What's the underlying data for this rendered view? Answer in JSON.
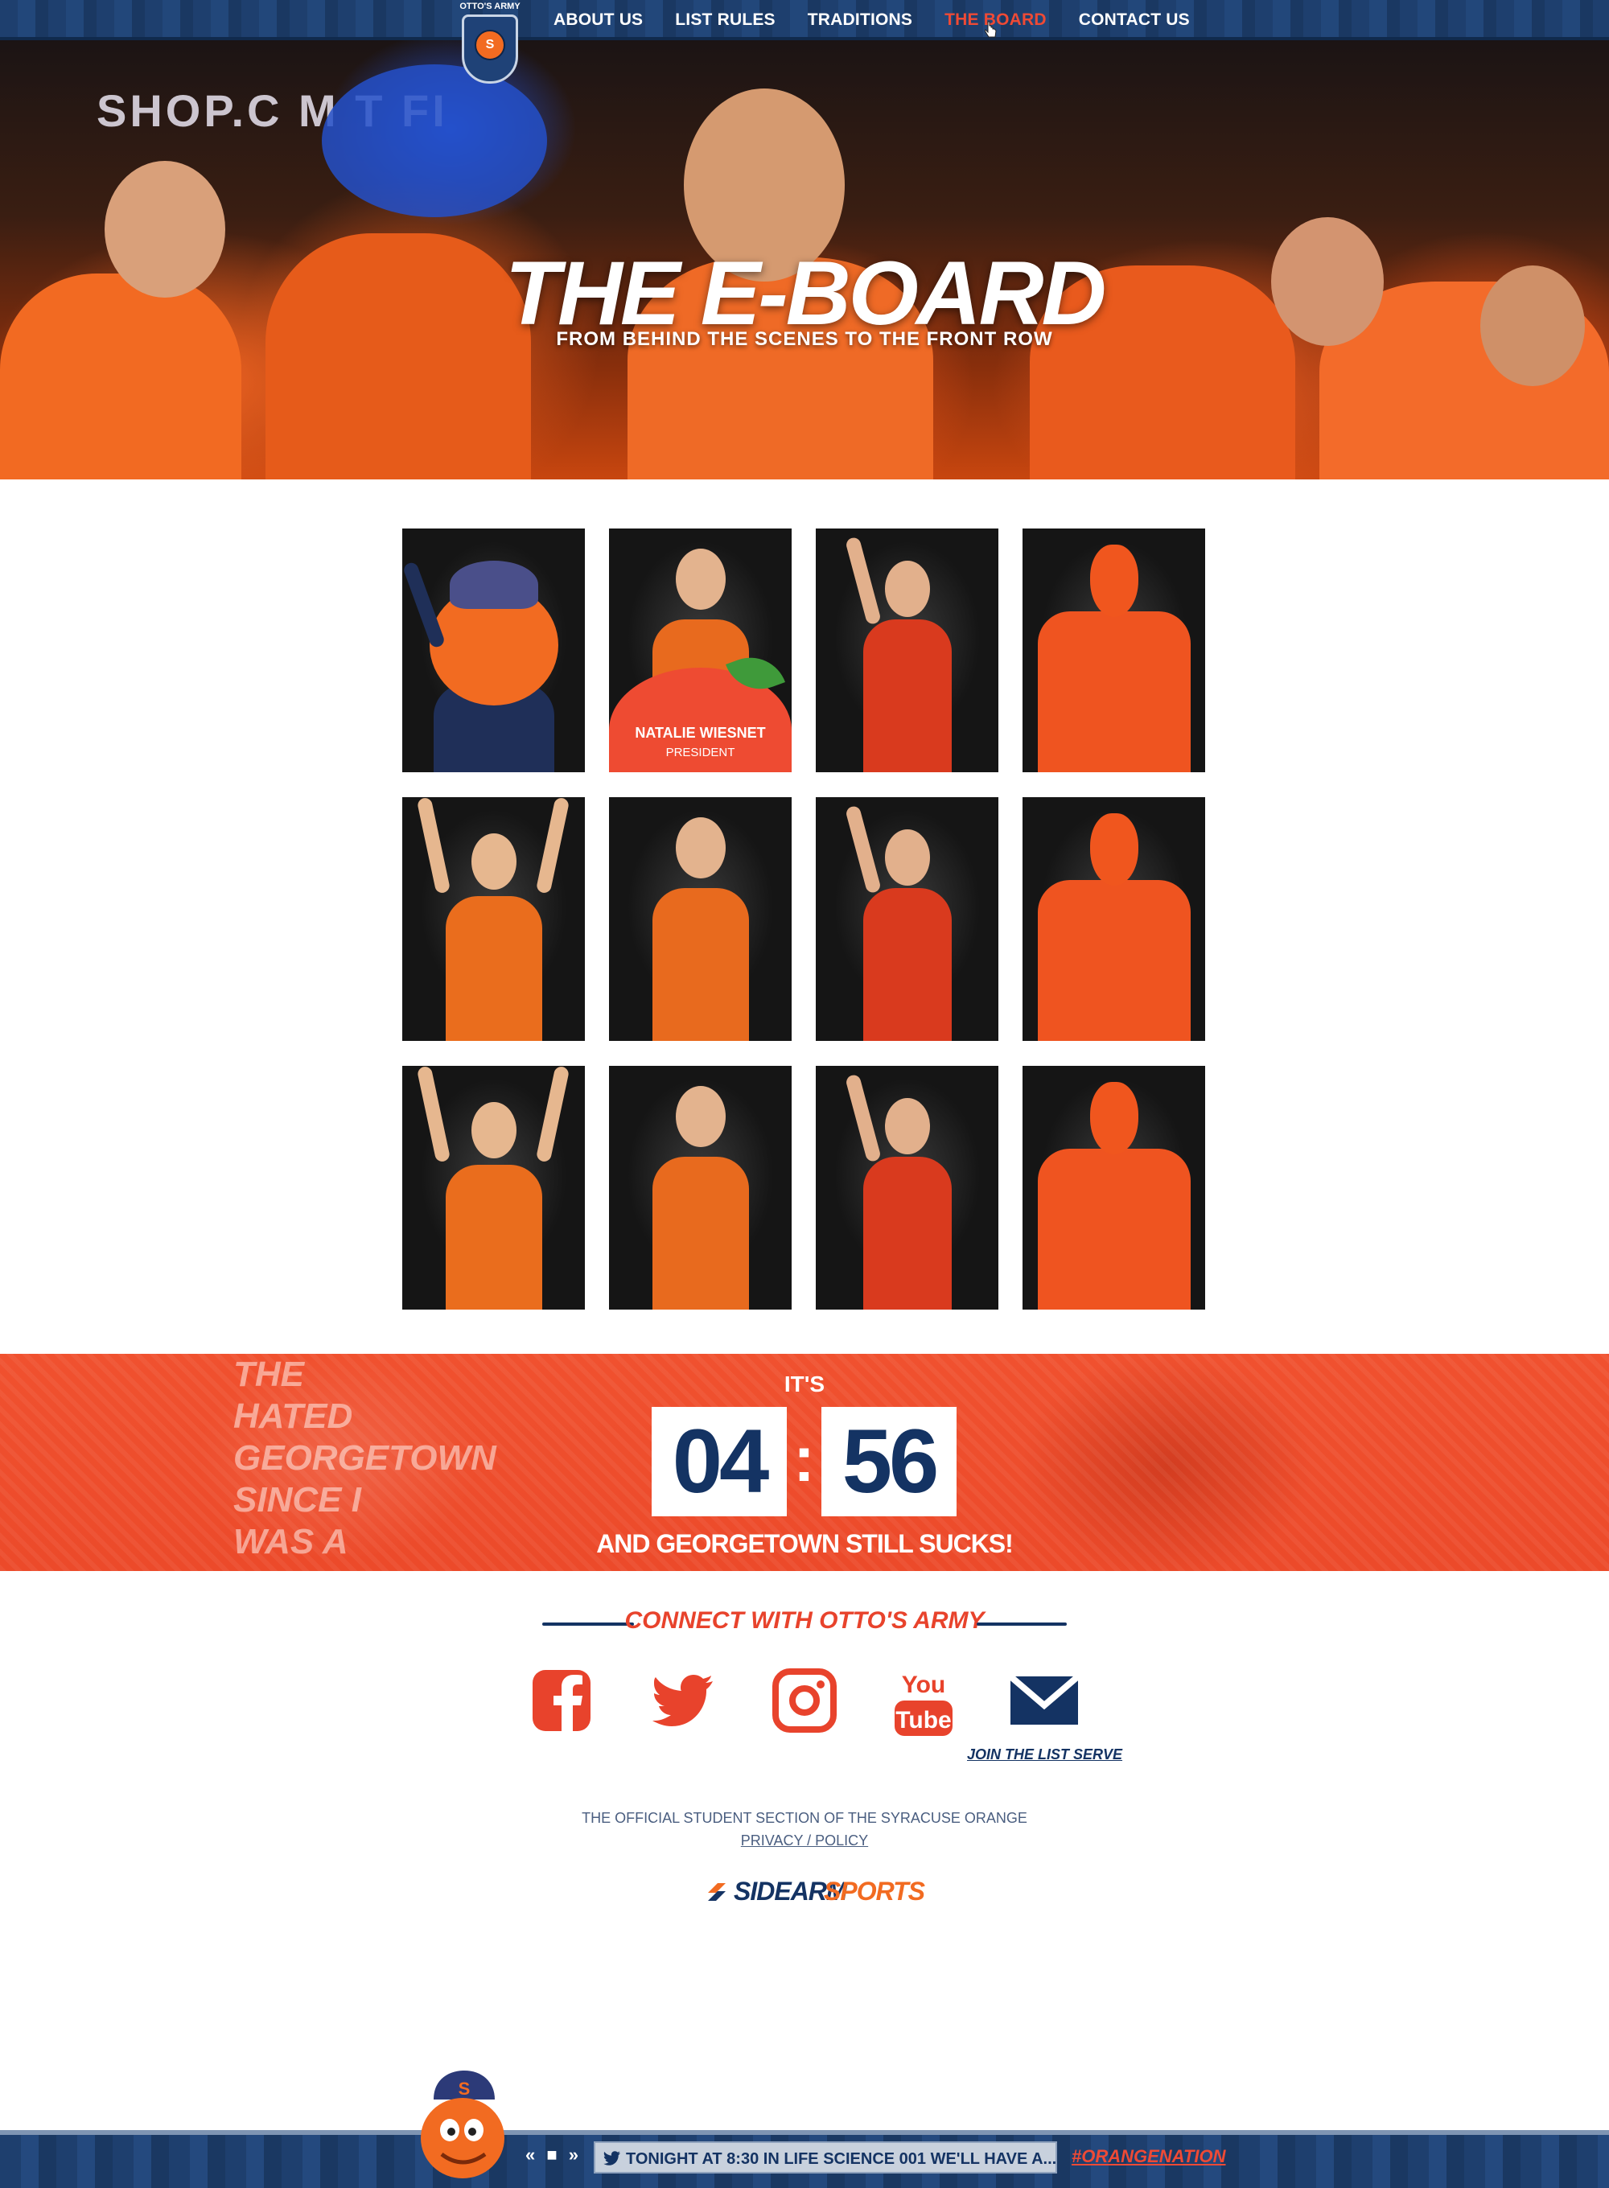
{
  "logo": {
    "tag": "OTTO'S ARMY",
    "letter": "S"
  },
  "nav": {
    "items": [
      {
        "label": "ABOUT US",
        "active": false
      },
      {
        "label": "LIST RULES",
        "active": false
      },
      {
        "label": "TRADITIONS",
        "active": false
      },
      {
        "label": "THE BOARD",
        "active": true
      },
      {
        "label": "CONTACT US",
        "active": false
      }
    ]
  },
  "hero": {
    "title": "THE E-BOARD",
    "subtitle": "FROM BEHIND THE SCENES TO THE FRONT ROW",
    "banner_text": "SHOP.C   M T   FI"
  },
  "board": {
    "members": [
      {
        "photo": "mascot-otto",
        "overlay": false
      },
      {
        "photo": "fan-cheering-hands",
        "overlay": true,
        "name": "NATALIE WIESNET",
        "role": "PRESIDENT"
      },
      {
        "photo": "fan-red-jersey-fist",
        "overlay": false
      },
      {
        "photo": "fan-orange-batman",
        "overlay": false
      },
      {
        "photo": "fan-arms-raised",
        "overlay": false
      },
      {
        "photo": "fan-cheering-hands",
        "overlay": false
      },
      {
        "photo": "fan-red-jersey-fist",
        "overlay": false
      },
      {
        "photo": "fan-orange-batman",
        "overlay": false
      },
      {
        "photo": "fan-arms-raised",
        "overlay": false
      },
      {
        "photo": "fan-cheering-hands",
        "overlay": false
      },
      {
        "photo": "fan-red-jersey-fist",
        "overlay": false
      },
      {
        "photo": "fan-orange-batman",
        "overlay": false
      }
    ]
  },
  "countdown": {
    "prefix": "IT'S",
    "hours": "04",
    "minutes": "56",
    "separator": ":",
    "suffix": "AND GEORGETOWN STILL SUCKS!",
    "sign_text": "THE HATED GEORGETOWN SINCE I WAS A LITTLE KID"
  },
  "connect": {
    "title": "CONNECT WITH OTTO'S ARMY",
    "icons": [
      "facebook-icon",
      "twitter-icon",
      "instagram-icon",
      "youtube-icon",
      "email-icon"
    ],
    "youtube_top": "You",
    "youtube_bottom": "Tube",
    "join_label": "JOIN THE LIST SERVE"
  },
  "footer": {
    "official": "THE OFFICIAL STUDENT SECTION OF THE SYRACUSE ORANGE",
    "privacy": "PRIVACY / POLICY",
    "brand_part1": "SIDEARM",
    "brand_part2": "SPORTS"
  },
  "ticker": {
    "controls": "« ■ »",
    "text": "TONIGHT AT 8:30 IN LIFE SCIENCE 001 WE'LL HAVE A...",
    "hashtag": "#ORANGENATION"
  },
  "colors": {
    "navy": "#143363",
    "orange": "#f26b21",
    "red": "#ef4a35"
  }
}
